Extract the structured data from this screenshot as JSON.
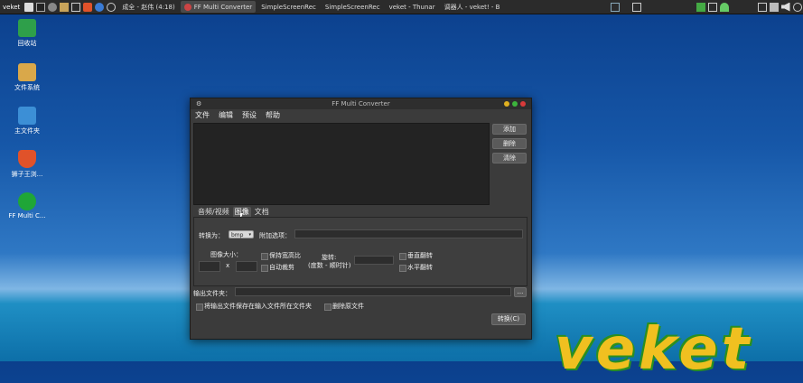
{
  "taskbar": {
    "start": "veket",
    "tasks": [
      {
        "label": "成全 - 赵伟 (4:18)"
      },
      {
        "label": "FF Multi Converter"
      },
      {
        "label": "SimpleScreenRec"
      },
      {
        "label": "SimpleScreenRec"
      },
      {
        "label": "veket - Thunar"
      },
      {
        "label": "调器人 - veket! - B"
      }
    ]
  },
  "desktop": [
    {
      "label": "回收站",
      "icon": "trash-icon",
      "color": "#2e9f4a"
    },
    {
      "label": "文件系统",
      "icon": "filesystem-icon",
      "color": "#d9a84a"
    },
    {
      "label": "主文件夹",
      "icon": "home-folder-icon",
      "color": "#3c8fd6"
    },
    {
      "label": "狮子王浏...",
      "icon": "brave-browser-icon",
      "color": "#e0522a"
    },
    {
      "label": "FF Multi C...",
      "icon": "ff-multi-converter-icon",
      "color": "#1fa637"
    }
  ],
  "window": {
    "title": "FF Multi Converter",
    "menu": [
      "文件",
      "编辑",
      "预设",
      "帮助"
    ],
    "side_buttons": {
      "add": "添加",
      "delete": "删除",
      "clear": "清除"
    },
    "tabs": [
      "音频/视频",
      "图像",
      "文档"
    ],
    "convert_to_label": "转换为：",
    "format_value": "bmp",
    "extra_options_label": "附加选项：",
    "image_size_label": "图像大小：",
    "x_label": "x",
    "keep_ratio_label": "保持宽高比",
    "auto_crop_label": "自动裁剪",
    "rotate_label": "旋转:",
    "rotate_sub_label": "(度数 - 顺时针)",
    "vflip_label": "垂直翻转",
    "hflip_label": "水平翻转",
    "output_folder_label": "输出文件夹：",
    "browse_label": "...",
    "save_in_source_label": "将输出文件保存在输入文件所在文件夹",
    "delete_original_label": "删除原文件",
    "convert_button": "转换(C)"
  },
  "watermark": "veket"
}
